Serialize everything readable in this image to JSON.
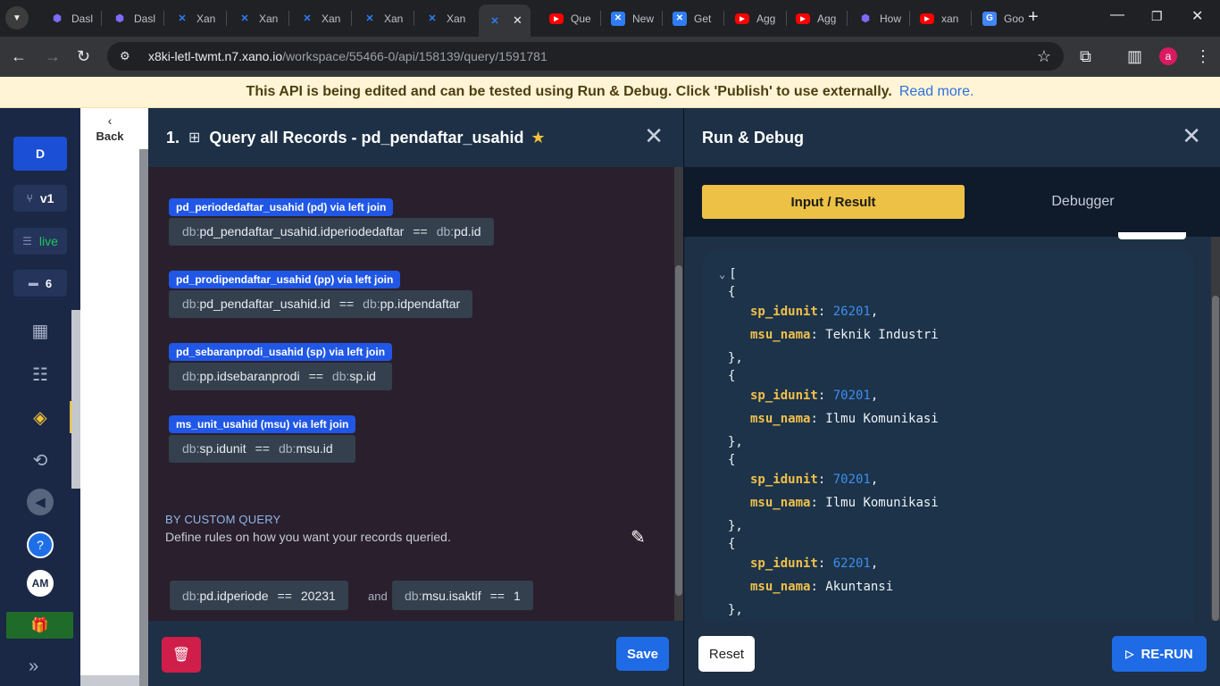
{
  "browser": {
    "tabs": [
      {
        "title": "Dasl",
        "favicon": "dash-cube-icon"
      },
      {
        "title": "Dasl",
        "favicon": "dash-cube-icon"
      },
      {
        "title": "Xan",
        "favicon": "xano-icon"
      },
      {
        "title": "Xan",
        "favicon": "xano-icon"
      },
      {
        "title": "Xan",
        "favicon": "xano-icon"
      },
      {
        "title": "Xan",
        "favicon": "xano-icon"
      },
      {
        "title": "Xan",
        "favicon": "xano-icon"
      },
      {
        "title": "",
        "favicon": "xano-icon",
        "active": true
      },
      {
        "title": "Que",
        "favicon": "youtube-icon"
      },
      {
        "title": "New",
        "favicon": "x-icon"
      },
      {
        "title": "Get",
        "favicon": "x-icon"
      },
      {
        "title": "Agg",
        "favicon": "youtube-icon"
      },
      {
        "title": "Agg",
        "favicon": "youtube-icon"
      },
      {
        "title": "How",
        "favicon": "dash-cube-icon"
      },
      {
        "title": "xan",
        "favicon": "youtube-icon"
      },
      {
        "title": "Goo",
        "favicon": "google-translate-icon"
      }
    ],
    "url_host": "x8ki-letl-twmt.n7.xano.io",
    "url_path": "/workspace/55466-0/api/158139/query/1591781",
    "profile_initial": "a"
  },
  "banner": {
    "message": "This API is being edited and can be tested using Run & Debug. Click 'Publish' to use externally.",
    "link": "Read more."
  },
  "sidebar": {
    "workspace_initial": "D",
    "branch": "v1",
    "status": "live",
    "comment_count": "6",
    "user_initials": "AM"
  },
  "back": {
    "label": "Back"
  },
  "query_panel": {
    "number": "1.",
    "title": "Query all Records - pd_pendaftar_usahid",
    "joins": [
      {
        "tag": "pd_periodedaftar_usahid (pd) via left join",
        "left_prefix": "db:",
        "left": "pd_pendaftar_usahid.idperiodedaftar",
        "op": "==",
        "right_prefix": "db:",
        "right": "pd.id"
      },
      {
        "tag": "pd_prodipendaftar_usahid (pp) via left join",
        "left_prefix": "db:",
        "left": "pd_pendaftar_usahid.id",
        "op": "==",
        "right_prefix": "db:",
        "right": "pp.idpendaftar"
      },
      {
        "tag": "pd_sebaranprodi_usahid (sp) via left join",
        "left_prefix": "db:",
        "left": "pp.idsebaranprodi",
        "op": "==",
        "right_prefix": "db:",
        "right": "sp.id"
      },
      {
        "tag": "ms_unit_usahid (msu) via left join",
        "left_prefix": "db:",
        "left": "sp.idunit",
        "op": "==",
        "right_prefix": "db:",
        "right": "msu.id"
      }
    ],
    "custom_query_heading": "BY CUSTOM QUERY",
    "custom_query_desc": "Define rules on how you want your records queried.",
    "conditions": [
      {
        "prefix": "db:",
        "field": "pd.idperiode",
        "op": "==",
        "value": "20231"
      },
      {
        "prefix": "db:",
        "field": "msu.isaktif",
        "op": "==",
        "value": "1"
      }
    ],
    "conjunction": "and",
    "save_label": "Save"
  },
  "run_debug": {
    "title": "Run & Debug",
    "tab_input": "Input / Result",
    "tab_debugger": "Debugger",
    "result_open": "[",
    "records": [
      {
        "sp_idunit": "26201",
        "msu_nama": "Teknik Industri"
      },
      {
        "sp_idunit": "70201",
        "msu_nama": "Ilmu Komunikasi"
      },
      {
        "sp_idunit": "70201",
        "msu_nama": "Ilmu Komunikasi"
      },
      {
        "sp_idunit": "62201",
        "msu_nama": "Akuntansi"
      }
    ],
    "key_1": "sp_idunit",
    "key_2": "msu_nama",
    "reset_label": "Reset",
    "rerun_label": "RE-RUN"
  },
  "colors": {
    "accent_yellow": "#ecc145",
    "primary_blue": "#1f6be6",
    "danger_red": "#d01e4b",
    "panel_navy": "#1d3046",
    "json_key": "#f2c04a",
    "json_number": "#3f8ef0"
  }
}
